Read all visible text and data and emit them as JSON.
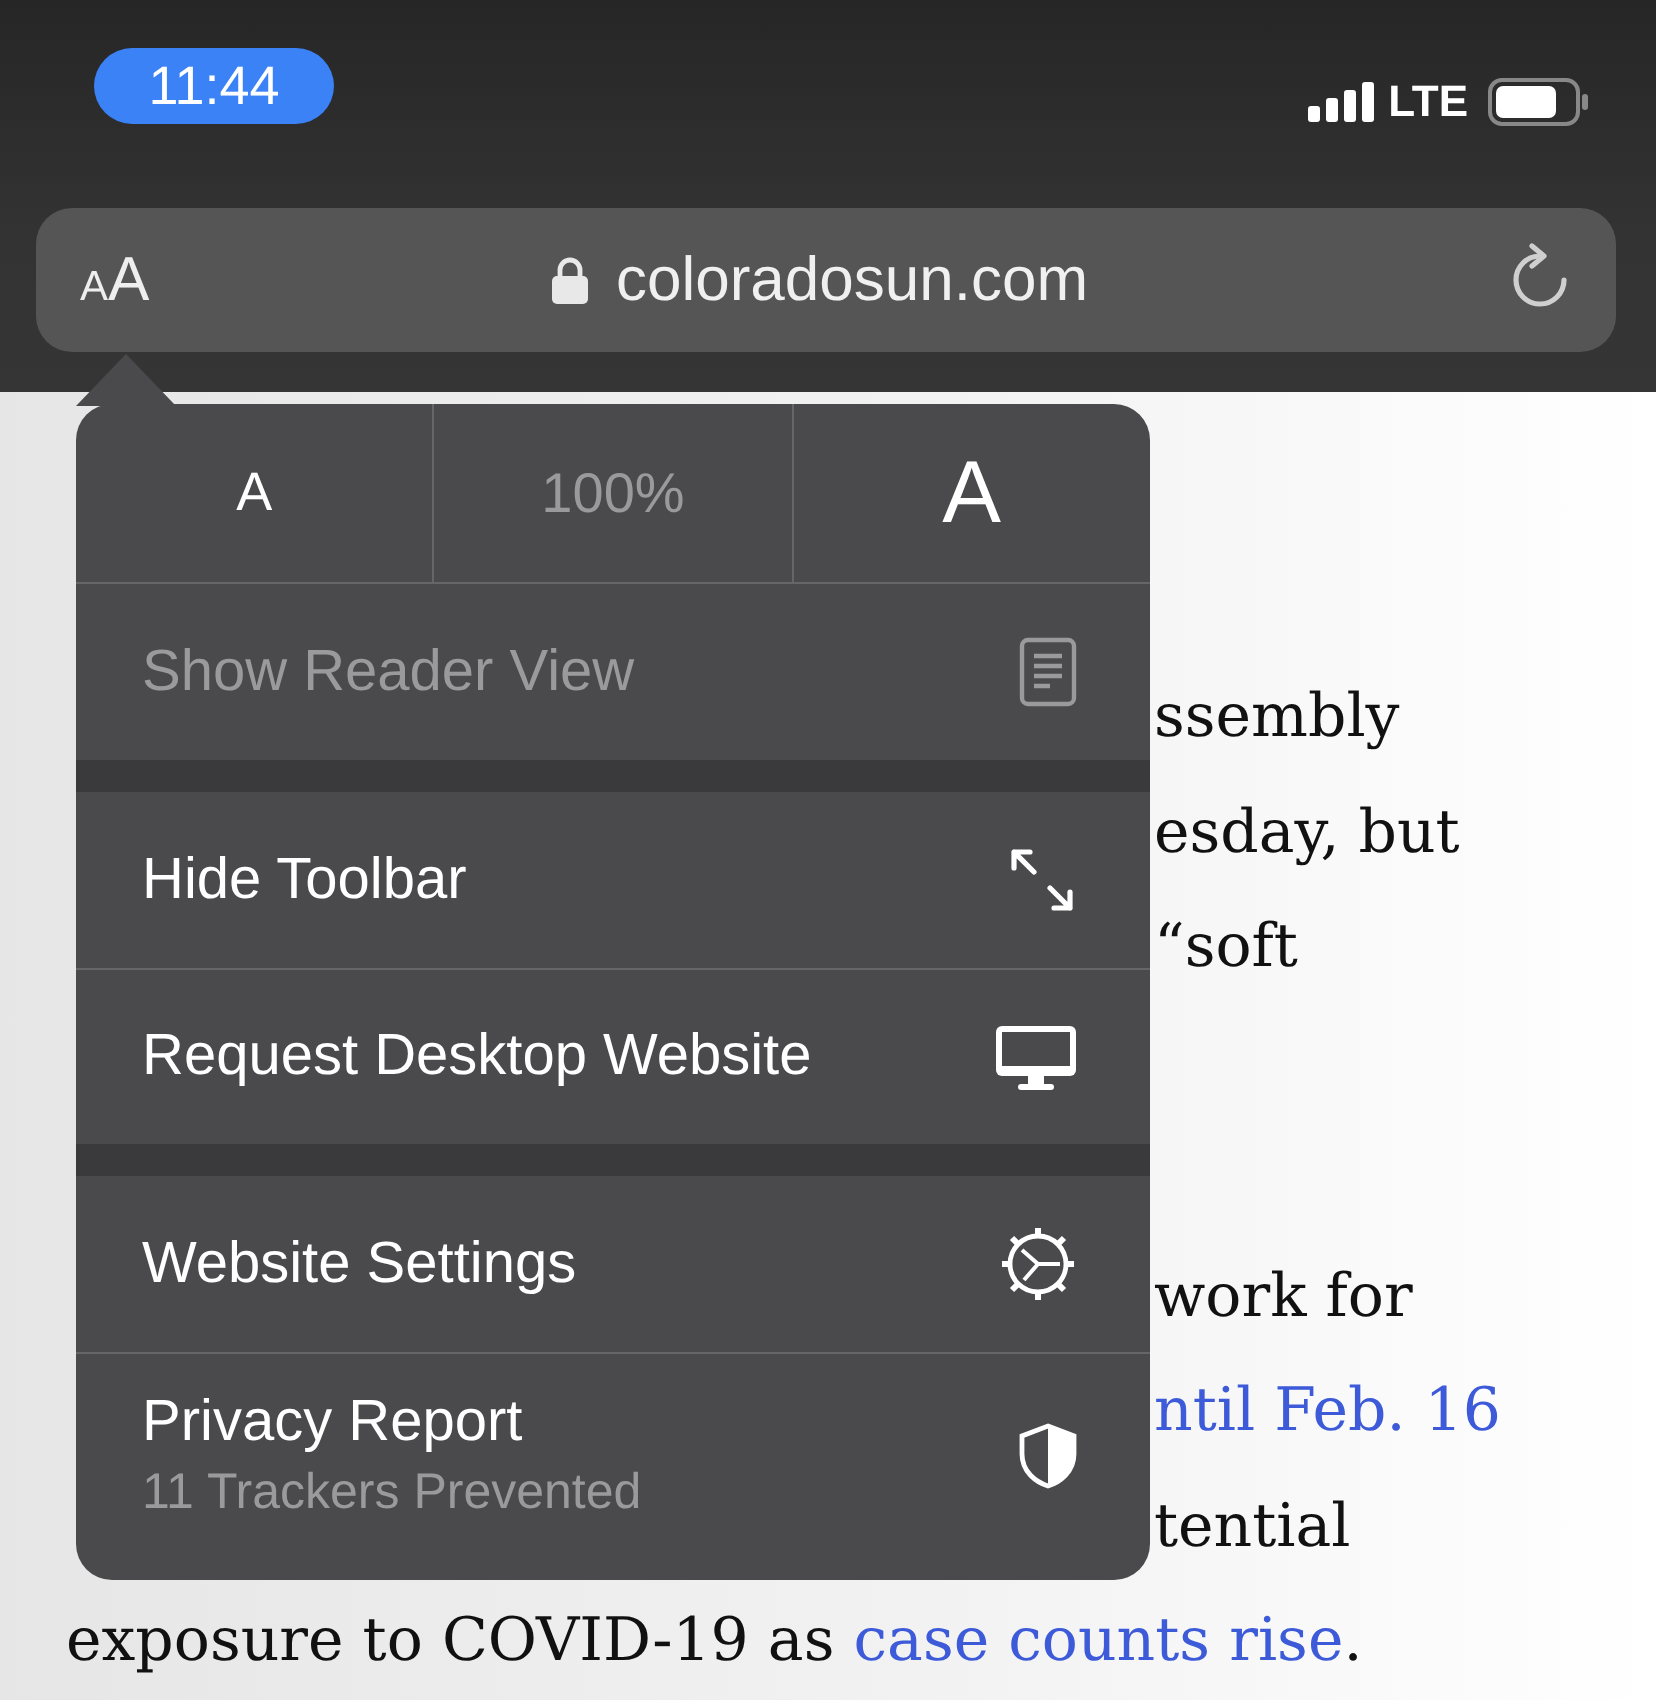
{
  "status_bar": {
    "time": "11:44",
    "network": "LTE"
  },
  "address_bar": {
    "format_button": "AA",
    "secure": true,
    "url": "coloradosun.com"
  },
  "menu": {
    "zoom": {
      "decrease": "A",
      "level": "100%",
      "increase": "A"
    },
    "sections": [
      {
        "items": [
          {
            "kind": "reader",
            "label": "Show Reader View",
            "disabled": true
          }
        ]
      },
      {
        "items": [
          {
            "kind": "toolbar",
            "label": "Hide Toolbar",
            "disabled": false
          },
          {
            "kind": "desktop",
            "label": "Request Desktop Website",
            "disabled": false
          }
        ]
      },
      {
        "items": [
          {
            "kind": "settings",
            "label": "Website Settings",
            "disabled": false
          },
          {
            "kind": "privacy",
            "label": "Privacy Report",
            "detail": "11 Trackers Prevented",
            "disabled": false
          }
        ]
      }
    ]
  },
  "article": {
    "paragraphs": [
      {
        "lines": [
          [
            {
              "text": "ssembly"
            }
          ],
          [
            {
              "text": "esday, but"
            }
          ],
          [
            {
              "text": "“soft"
            }
          ]
        ]
      },
      {
        "lines": [
          [
            {
              "text": "work for"
            }
          ],
          [
            {
              "text": "ntil Feb. 16",
              "link": true
            }
          ],
          [
            {
              "text": "tential"
            }
          ]
        ]
      },
      {
        "lines": [
          [
            {
              "text": "exposure to COVID-19 as "
            },
            {
              "text": "case counts rise",
              "link": true
            },
            {
              "text": "."
            }
          ]
        ]
      }
    ]
  }
}
